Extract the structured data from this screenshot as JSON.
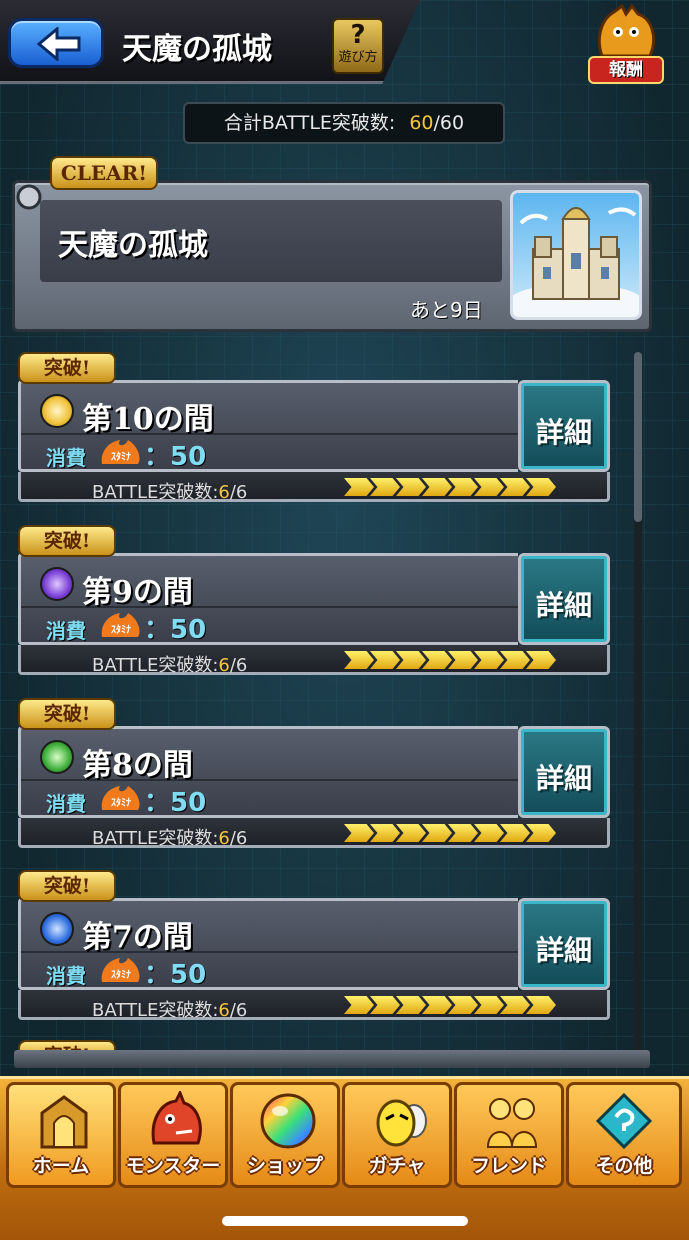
{
  "header": {
    "title": "天魔の孤城",
    "help_label": "遊び方",
    "help_icon": "?",
    "reward_label": "報酬"
  },
  "summary": {
    "label": "合計BATTLE突破数:",
    "current": "60",
    "max": "/60"
  },
  "stage_card": {
    "clear_badge": "CLEAR!",
    "title": "天魔の孤城",
    "remaining": "あと9日"
  },
  "rooms": [
    {
      "badge": "突破!",
      "name": "第10の間",
      "element": "light",
      "element_color": "#f0c23a",
      "cost_label": "消費",
      "stamina_label": "ｽﾀﾐﾅ",
      "cost_value": "：50",
      "battle_label": "BATTLE突破数:",
      "battle_current": "6",
      "battle_max": "/6",
      "progress": 1.0,
      "detail_label": "詳細"
    },
    {
      "badge": "突破!",
      "name": "第9の間",
      "element": "dark",
      "element_color": "#7a3fd6",
      "cost_label": "消費",
      "stamina_label": "ｽﾀﾐﾅ",
      "cost_value": "：50",
      "battle_label": "BATTLE突破数:",
      "battle_current": "6",
      "battle_max": "/6",
      "progress": 1.0,
      "detail_label": "詳細"
    },
    {
      "badge": "突破!",
      "name": "第8の間",
      "element": "wood",
      "element_color": "#3fae3a",
      "cost_label": "消費",
      "stamina_label": "ｽﾀﾐﾅ",
      "cost_value": "：50",
      "battle_label": "BATTLE突破数:",
      "battle_current": "6",
      "battle_max": "/6",
      "progress": 1.0,
      "detail_label": "詳細"
    },
    {
      "badge": "突破!",
      "name": "第7の間",
      "element": "water",
      "element_color": "#2f6fe0",
      "cost_label": "消費",
      "stamina_label": "ｽﾀﾐﾅ",
      "cost_value": "：50",
      "battle_label": "BATTLE突破数:",
      "battle_current": "6",
      "battle_max": "/6",
      "progress": 1.0,
      "detail_label": "詳細"
    }
  ],
  "partial_badge": "突破!",
  "nav": [
    {
      "label": "ホーム",
      "icon": "home-gate-icon"
    },
    {
      "label": "モンスター",
      "icon": "dragon-icon"
    },
    {
      "label": "ショップ",
      "icon": "rainbow-orb-icon"
    },
    {
      "label": "ガチャ",
      "icon": "gacha-egg-icon"
    },
    {
      "label": "フレンド",
      "icon": "friends-icon"
    },
    {
      "label": "その他",
      "icon": "other-icon"
    }
  ],
  "colors": {
    "gold": "#f5c542",
    "cyan_text": "#7fdcf2",
    "nav_orange": "#f09a20"
  }
}
